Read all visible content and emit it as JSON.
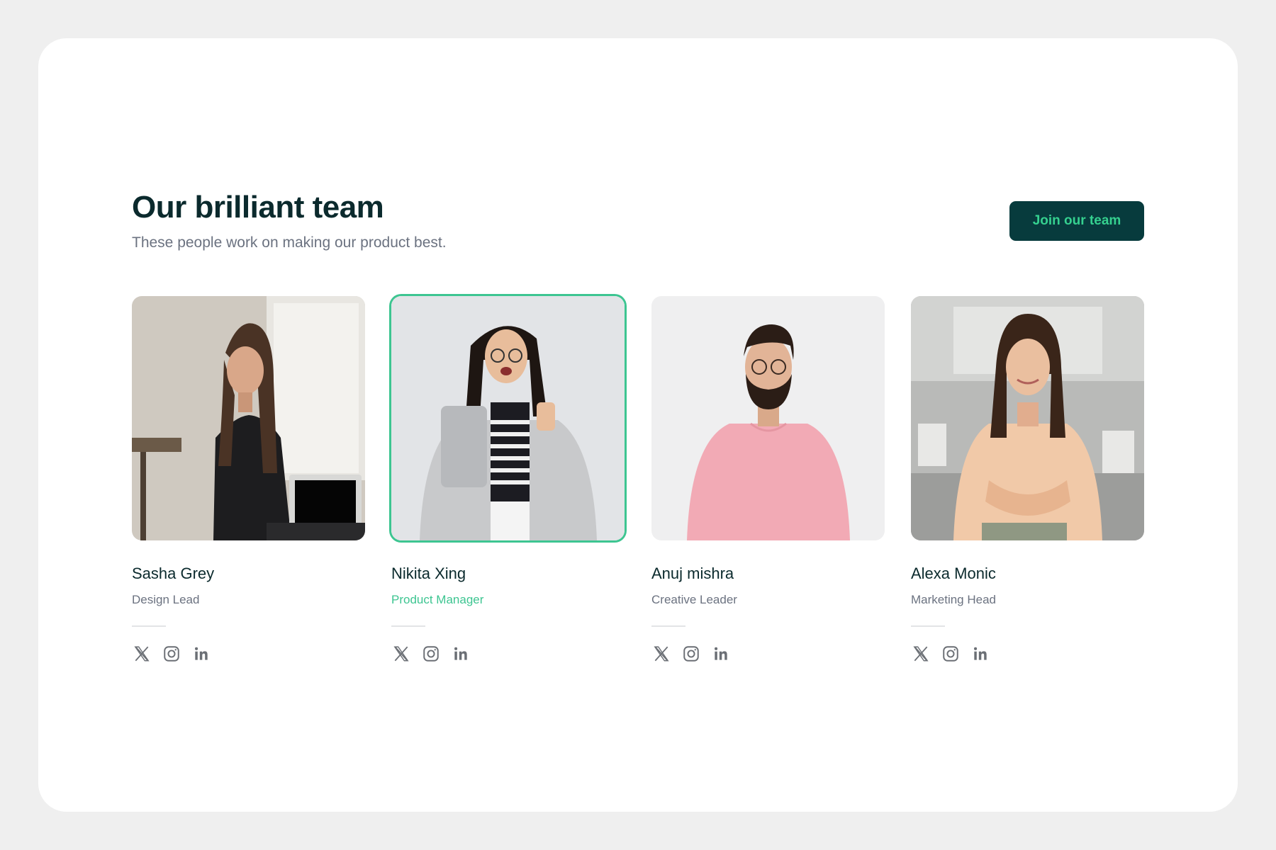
{
  "header": {
    "title": "Our brilliant team",
    "subtitle": "These people work on making our product best.",
    "cta_label": "Join our team"
  },
  "colors": {
    "accent": "#3dc591",
    "dark": "#073b3d",
    "cta_text": "#35d08f",
    "text_dark": "#0b2a2d",
    "text_muted": "#6b7280"
  },
  "members": [
    {
      "name": "Sasha Grey",
      "role": "Design Lead",
      "active": false
    },
    {
      "name": "Nikita Xing",
      "role": "Product Manager",
      "active": true
    },
    {
      "name": "Anuj mishra",
      "role": "Creative Leader",
      "active": false
    },
    {
      "name": "Alexa Monic",
      "role": "Marketing Head",
      "active": false
    }
  ],
  "social_icons": [
    "x-icon",
    "instagram-icon",
    "linkedin-icon"
  ]
}
